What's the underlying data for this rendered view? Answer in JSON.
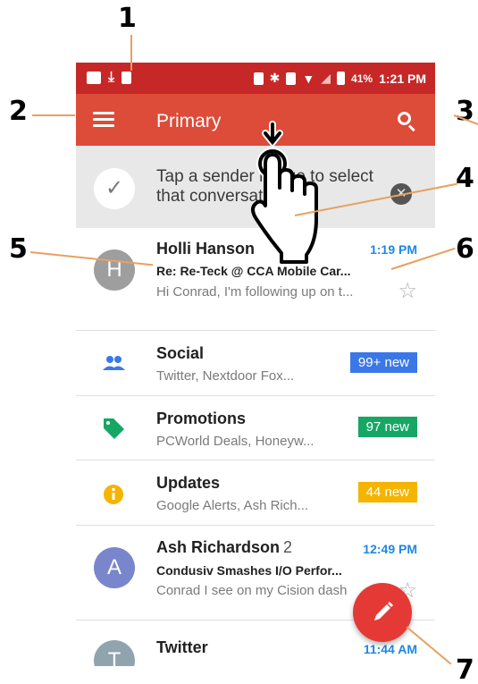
{
  "callouts": [
    "1",
    "2",
    "3",
    "4",
    "5",
    "6",
    "7"
  ],
  "status_bar": {
    "battery": "41%",
    "time": "1:21 PM"
  },
  "app_bar": {
    "title": "Primary"
  },
  "tip": {
    "text": "Tap a sender image to select that conversation."
  },
  "emails": [
    {
      "initial": "H",
      "sender": "Holli Hanson",
      "count": "",
      "time": "1:19 PM",
      "subject": "Re: Re-Teck @ CCA Mobile Car...",
      "snippet": "Hi Conrad, I'm following up on t...",
      "avatar_color": "#9e9e9e"
    },
    {
      "initial": "A",
      "sender": "Ash Richardson",
      "count": "2",
      "time": "12:49 PM",
      "subject": "Condusiv Smashes I/O Perfor...",
      "snippet": "Conrad I see on my Cision dash",
      "avatar_color": "#7986cb"
    },
    {
      "initial": "T",
      "sender": "Twitter",
      "count": "",
      "time": "11:44 AM",
      "subject": "",
      "snippet": "",
      "avatar_color": "#90a4ae"
    }
  ],
  "categories": [
    {
      "title": "Social",
      "subtitle": "Twitter, Nextdoor Fox...",
      "badge": "99+ new",
      "color": "#3b78e7"
    },
    {
      "title": "Promotions",
      "subtitle": "PCWorld Deals, Honeyw...",
      "badge": "97 new",
      "color": "#16a765"
    },
    {
      "title": "Updates",
      "subtitle": "Google Alerts, Ash Rich...",
      "badge": "44 new",
      "color": "#f4b400"
    }
  ],
  "colors": {
    "app_bar": "#dd4b39",
    "status_bar": "#c62828",
    "fab": "#e53935",
    "callout_line": "#e8a060"
  }
}
